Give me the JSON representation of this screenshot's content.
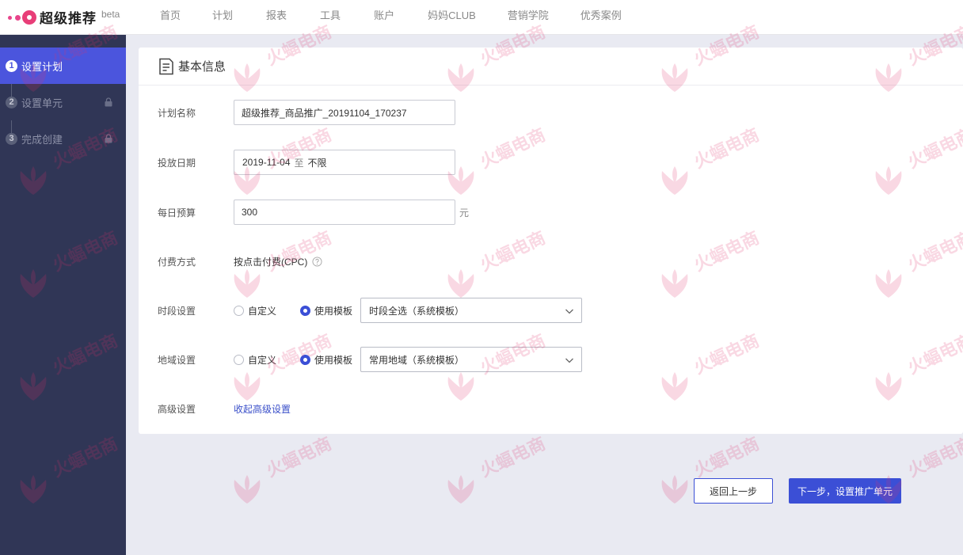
{
  "app": {
    "name": "超级推荐",
    "badge": "beta"
  },
  "nav": [
    "首页",
    "计划",
    "报表",
    "工具",
    "账户",
    "妈妈CLUB",
    "营销学院",
    "优秀案例"
  ],
  "steps": [
    {
      "num": "1",
      "label": "设置计划",
      "state": "active"
    },
    {
      "num": "2",
      "label": "设置单元",
      "state": "locked"
    },
    {
      "num": "3",
      "label": "完成创建",
      "state": "locked"
    }
  ],
  "card": {
    "title": "基本信息"
  },
  "form": {
    "plan_name": {
      "label": "计划名称",
      "value": "超级推荐_商品推广_20191104_170237"
    },
    "dates": {
      "label": "投放日期",
      "start": "2019-11-04",
      "sep": "至",
      "end": "不限"
    },
    "budget": {
      "label": "每日预算",
      "value": "300",
      "unit": "元"
    },
    "billing": {
      "label": "付费方式",
      "value": "按点击付费(CPC)"
    },
    "time": {
      "label": "时段设置",
      "opt_custom": "自定义",
      "opt_template": "使用模板",
      "selected": "使用模板",
      "template": "时段全选（系统模板）"
    },
    "region": {
      "label": "地域设置",
      "opt_custom": "自定义",
      "opt_template": "使用模板",
      "selected": "使用模板",
      "template": "常用地域（系统模板）"
    },
    "advanced": {
      "label": "高级设置",
      "link": "收起高级设置"
    }
  },
  "buttons": {
    "back": "返回上一步",
    "next": "下一步，设置推广单元"
  },
  "watermark": {
    "text": "火蝠电商"
  },
  "colors": {
    "primary": "#3b4fd6",
    "sidebar": "#303656",
    "active_step": "#4b55dd",
    "brand": "#e83e78"
  }
}
